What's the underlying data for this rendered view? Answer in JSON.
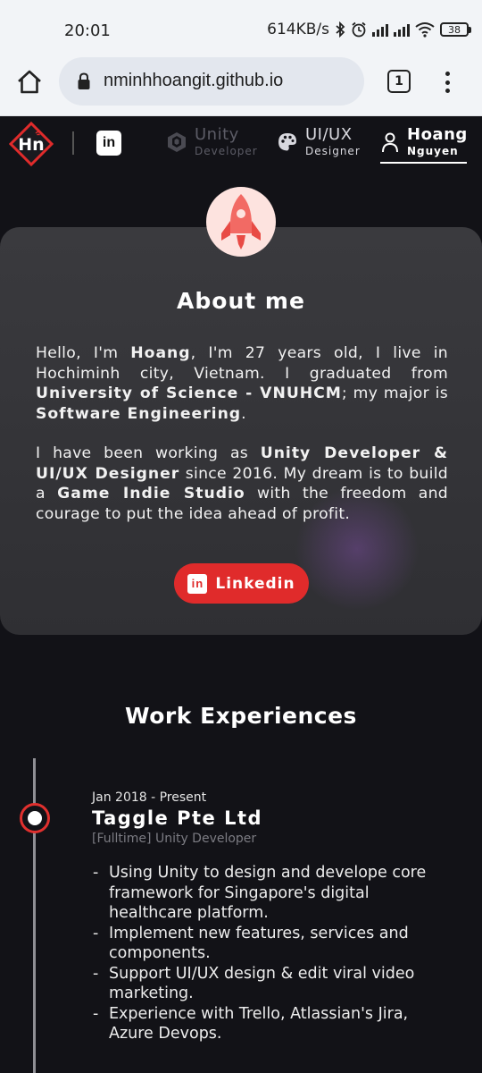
{
  "status_bar": {
    "time": "20:01",
    "network_speed": "614KB/s",
    "battery": "38"
  },
  "browser": {
    "url": "nminhhoangit.github.io",
    "tab_count": "1"
  },
  "nav": {
    "linkedin_icon": "in",
    "items": [
      {
        "main": "Unity",
        "sub": "Developer",
        "icon": "unity-icon"
      },
      {
        "main": "UI/UX",
        "sub": "Designer",
        "icon": "palette-icon"
      },
      {
        "main": "Hoang",
        "sub": "Nguyen",
        "icon": "person-icon"
      }
    ]
  },
  "about": {
    "title": "About me",
    "p1": {
      "t1": "Hello, I'm ",
      "b1": "Hoang",
      "t2": ", I'm 27 years old, I live in Hochiminh city, Vietnam. I graduated from ",
      "b2": "University of Science - VNUHCM",
      "t3": "; my major is ",
      "b3": "Software Engineering",
      "t4": "."
    },
    "p2": {
      "t1": "I have been working as ",
      "b1": "Unity Developer & UI/UX Designer",
      "t2": " since 2016. My dream is to build a ",
      "b2": "Game Indie Studio",
      "t3": " with the freedom and courage to put the idea ahead of profit."
    },
    "button_icon": "in",
    "button_label": "Linkedin"
  },
  "work": {
    "title": "Work Experiences",
    "jobs": [
      {
        "date": "Jan 2018 - Present",
        "company": "Taggle Pte Ltd",
        "role": "[Fulltime] Unity Developer",
        "items": [
          "Using Unity to design and develope core framework for Singapore's digital healthcare platform.",
          "Implement new features, services and components.",
          "Support UI/UX design & edit viral video marketing.",
          "Experience with Trello, Atlassian's Jira, Azure Devops."
        ]
      }
    ]
  },
  "colors": {
    "accent_red": "#e02b2b",
    "page_bg": "#121217",
    "card_bg": "#3a3a3e"
  }
}
